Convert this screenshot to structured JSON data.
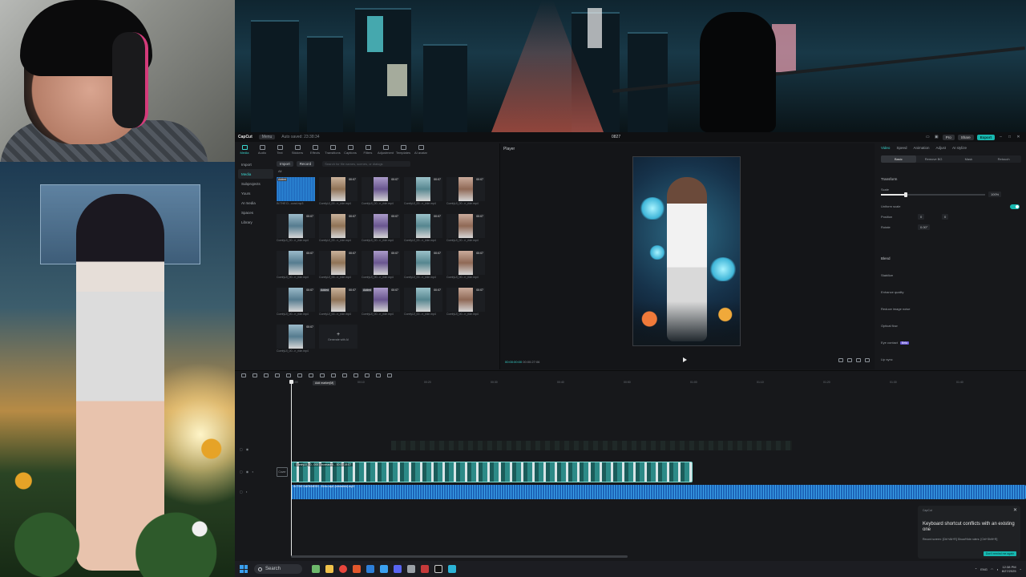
{
  "capcut": {
    "app_name": "CapCut",
    "menu_label": "Menu",
    "autosave": "Auto saved: 23:38:34",
    "project_name": "0827",
    "pro_label": "Pro",
    "share_label": "Share",
    "export_label": "Export",
    "toolbar": [
      "Media",
      "Audio",
      "Text",
      "Stickers",
      "Effects",
      "Transitions",
      "Captions",
      "Filters",
      "Adjustment",
      "Templates",
      "AI avatar"
    ],
    "sidebar": [
      "Import",
      "Media",
      "Subprojects",
      "Yours",
      "AI media",
      "Spaces",
      "Library"
    ],
    "import_label": "Import",
    "record_label": "Record",
    "search_placeholder": "Search for file names, scenes, or dialogs",
    "filter_all": "All",
    "media_items": [
      {
        "type": "audio",
        "badge": "Added",
        "duration": "",
        "name": "IN THE D...ound.mp3"
      },
      {
        "type": "video",
        "badge": "",
        "duration": "00:07",
        "name": "ComfyUI_00...n_ride.mp4"
      },
      {
        "type": "video",
        "badge": "",
        "duration": "00:07",
        "name": "ComfyUI_00...n_ride.mp4"
      },
      {
        "type": "video",
        "badge": "",
        "duration": "00:07",
        "name": "ComfyUI_00...n_ride.mp4"
      },
      {
        "type": "video",
        "badge": "",
        "duration": "00:07",
        "name": "ComfyUI_00...n_ride.mp4"
      },
      {
        "type": "video",
        "badge": "",
        "duration": "00:07",
        "name": "ComfyUI_00...n_ride.mp4"
      },
      {
        "type": "video",
        "badge": "",
        "duration": "00:07",
        "name": "ComfyUI_00...n_ride.mp4"
      },
      {
        "type": "video",
        "badge": "",
        "duration": "00:07",
        "name": "ComfyUI_00...n_ride.mp4"
      },
      {
        "type": "video",
        "badge": "",
        "duration": "00:07",
        "name": "ComfyUI_00...n_ride.mp4"
      },
      {
        "type": "video",
        "badge": "",
        "duration": "00:07",
        "name": "ComfyUI_00...n_ride.mp4"
      },
      {
        "type": "video",
        "badge": "",
        "duration": "00:07",
        "name": "ComfyUI_00...n_ride.mp4"
      },
      {
        "type": "video",
        "badge": "",
        "duration": "00:07",
        "name": "ComfyUI_00...n_ride.mp4"
      },
      {
        "type": "video",
        "badge": "",
        "duration": "00:07",
        "name": "ComfyUI_00...n_ride.mp4"
      },
      {
        "type": "video",
        "badge": "",
        "duration": "00:07",
        "name": "ComfyUI_00...n_ride.mp4"
      },
      {
        "type": "video",
        "badge": "",
        "duration": "00:07",
        "name": "ComfyUI_00...n_ride.mp4"
      },
      {
        "type": "video",
        "badge": "",
        "duration": "00:07",
        "name": "ComfyUI_00...n_ride.mp4"
      },
      {
        "type": "video",
        "badge": "Added",
        "duration": "00:07",
        "name": "ComfyUI_00...n_ride.mp4"
      },
      {
        "type": "video",
        "badge": "Added",
        "duration": "00:07",
        "name": "ComfyUI_00...n_ride.mp4"
      },
      {
        "type": "video",
        "badge": "",
        "duration": "00:07",
        "name": "ComfyUI_00...n_ride.mp4"
      },
      {
        "type": "video",
        "badge": "",
        "duration": "00:07",
        "name": "ComfyUI_00...n_ride.mp4"
      },
      {
        "type": "video",
        "badge": "",
        "duration": "00:07",
        "name": "ComfyUI_00...n_ride.mp4"
      },
      {
        "type": "generate",
        "badge": "",
        "duration": "",
        "name": "Generate with AI"
      }
    ],
    "player": {
      "title": "Player",
      "current_time": "00:00:00:00",
      "total_time": "00:00:27:06"
    },
    "right_panel": {
      "tabs": [
        "Video",
        "Speed",
        "Animation",
        "Adjust",
        "AI stylize"
      ],
      "subtabs": [
        "Basic",
        "Remove BG",
        "Mask",
        "Retouch"
      ],
      "transform_label": "Transform",
      "scale_label": "Scale",
      "scale_value": "100%",
      "uniform_scale_label": "Uniform scale",
      "position_label": "Position",
      "position_x": "0",
      "position_y": "0",
      "rotate_label": "Rotate",
      "rotate_value": "0.00°",
      "blend_label": "Blend",
      "stabilize_label": "Stabilize",
      "enhance_label": "Enhance quality",
      "noise_label": "Reduce image noise",
      "flow_label": "Optical flow",
      "eye_label": "Eye contact",
      "eye_badge": "Beta",
      "lip_label": "Lip sync"
    },
    "timeline": {
      "tooltip": "Add marker(M)",
      "ruler": [
        "00:00",
        "00:10",
        "00:20",
        "00:30",
        "00:40",
        "00:50",
        "01:00",
        "01:10",
        "01:20",
        "01:30",
        "01:40"
      ],
      "video_clip_label": "ComfyUI_00...0001-Increased... 00:00:19:07",
      "cover_label": "Cover",
      "audio_clip_label": "IN THE DARKNESS - Echo.mp4 (extracted).mp3"
    }
  },
  "toast": {
    "app": "CapCut",
    "message": "Keyboard shortcut conflicts with an existing one",
    "detail": "Record screen: [Ctrl+Alt+R]  Show/Hide rulers: [Ctrl+Shift+R]",
    "button": "Don't remind me again"
  },
  "taskbar": {
    "search_label": "Search",
    "language": "ENG",
    "time": "12:38 PM",
    "date": "8/27/2025"
  },
  "colors": {
    "accent": "#3ad6cf",
    "export": "#17b8b0",
    "audio": "#1d64b8"
  }
}
